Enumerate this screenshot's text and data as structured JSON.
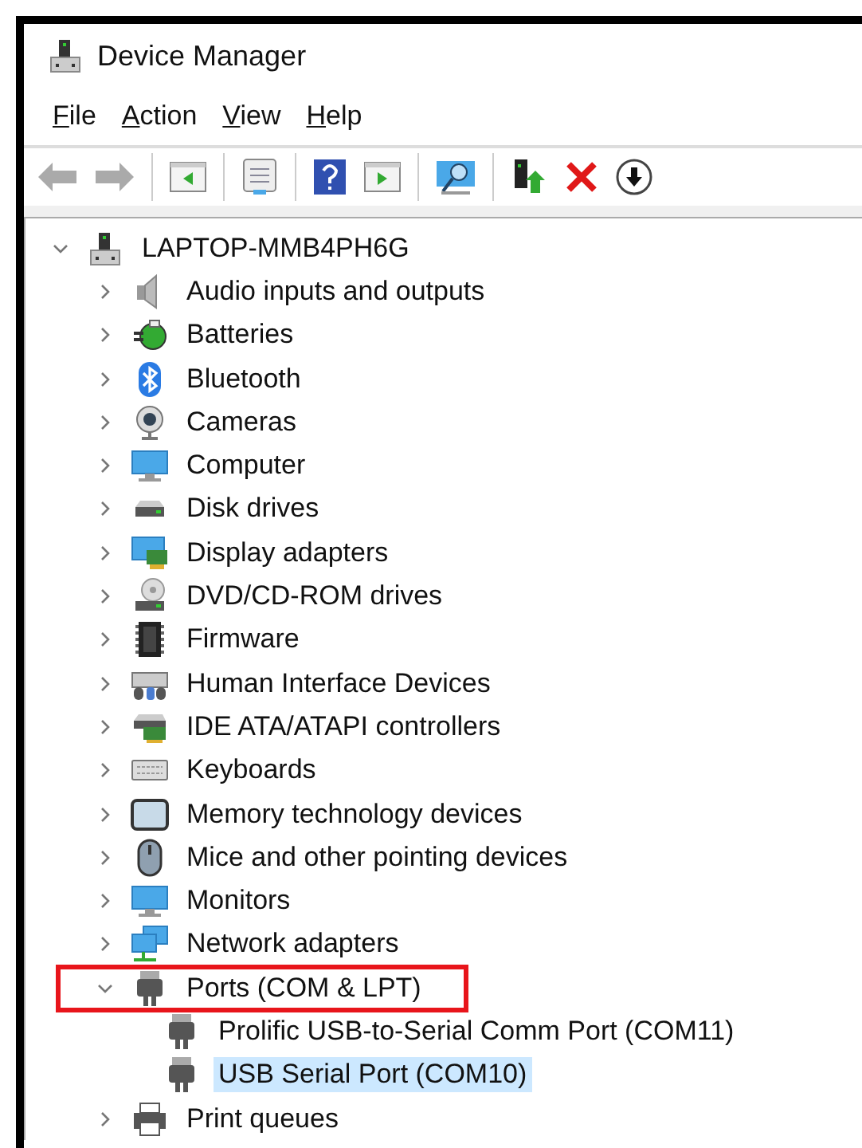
{
  "window": {
    "title": "Device Manager"
  },
  "menu": [
    "File",
    "Action",
    "View",
    "Help"
  ],
  "tree": {
    "label": "LAPTOP-MMB4PH6G",
    "expanded": true,
    "selected": false,
    "highlighted": false,
    "children": [
      {
        "label": "Audio inputs and outputs",
        "expanded": false,
        "selected": false,
        "highlighted": false
      },
      {
        "label": "Batteries",
        "expanded": false,
        "selected": false,
        "highlighted": false
      },
      {
        "label": "Bluetooth",
        "expanded": false,
        "selected": false,
        "highlighted": false
      },
      {
        "label": "Cameras",
        "expanded": false,
        "selected": false,
        "highlighted": false
      },
      {
        "label": "Computer",
        "expanded": false,
        "selected": false,
        "highlighted": false
      },
      {
        "label": "Disk drives",
        "expanded": false,
        "selected": false,
        "highlighted": false
      },
      {
        "label": "Display adapters",
        "expanded": false,
        "selected": false,
        "highlighted": false
      },
      {
        "label": "DVD/CD-ROM drives",
        "expanded": false,
        "selected": false,
        "highlighted": false
      },
      {
        "label": "Firmware",
        "expanded": false,
        "selected": false,
        "highlighted": false
      },
      {
        "label": "Human Interface Devices",
        "expanded": false,
        "selected": false,
        "highlighted": false
      },
      {
        "label": "IDE ATA/ATAPI controllers",
        "expanded": false,
        "selected": false,
        "highlighted": false
      },
      {
        "label": "Keyboards",
        "expanded": false,
        "selected": false,
        "highlighted": false
      },
      {
        "label": "Memory technology devices",
        "expanded": false,
        "selected": false,
        "highlighted": false
      },
      {
        "label": "Mice and other pointing devices",
        "expanded": false,
        "selected": false,
        "highlighted": false
      },
      {
        "label": "Monitors",
        "expanded": false,
        "selected": false,
        "highlighted": false
      },
      {
        "label": "Network adapters",
        "expanded": false,
        "selected": false,
        "highlighted": false
      },
      {
        "label": "Ports (COM & LPT)",
        "expanded": true,
        "selected": false,
        "highlighted": true,
        "children": [
          {
            "label": "Prolific USB-to-Serial Comm Port (COM11)",
            "selected": false,
            "highlighted": false
          },
          {
            "label": "USB Serial Port (COM10)",
            "selected": true,
            "highlighted": false
          }
        ]
      },
      {
        "label": "Print queues",
        "expanded": false,
        "selected": false,
        "highlighted": false
      }
    ]
  }
}
